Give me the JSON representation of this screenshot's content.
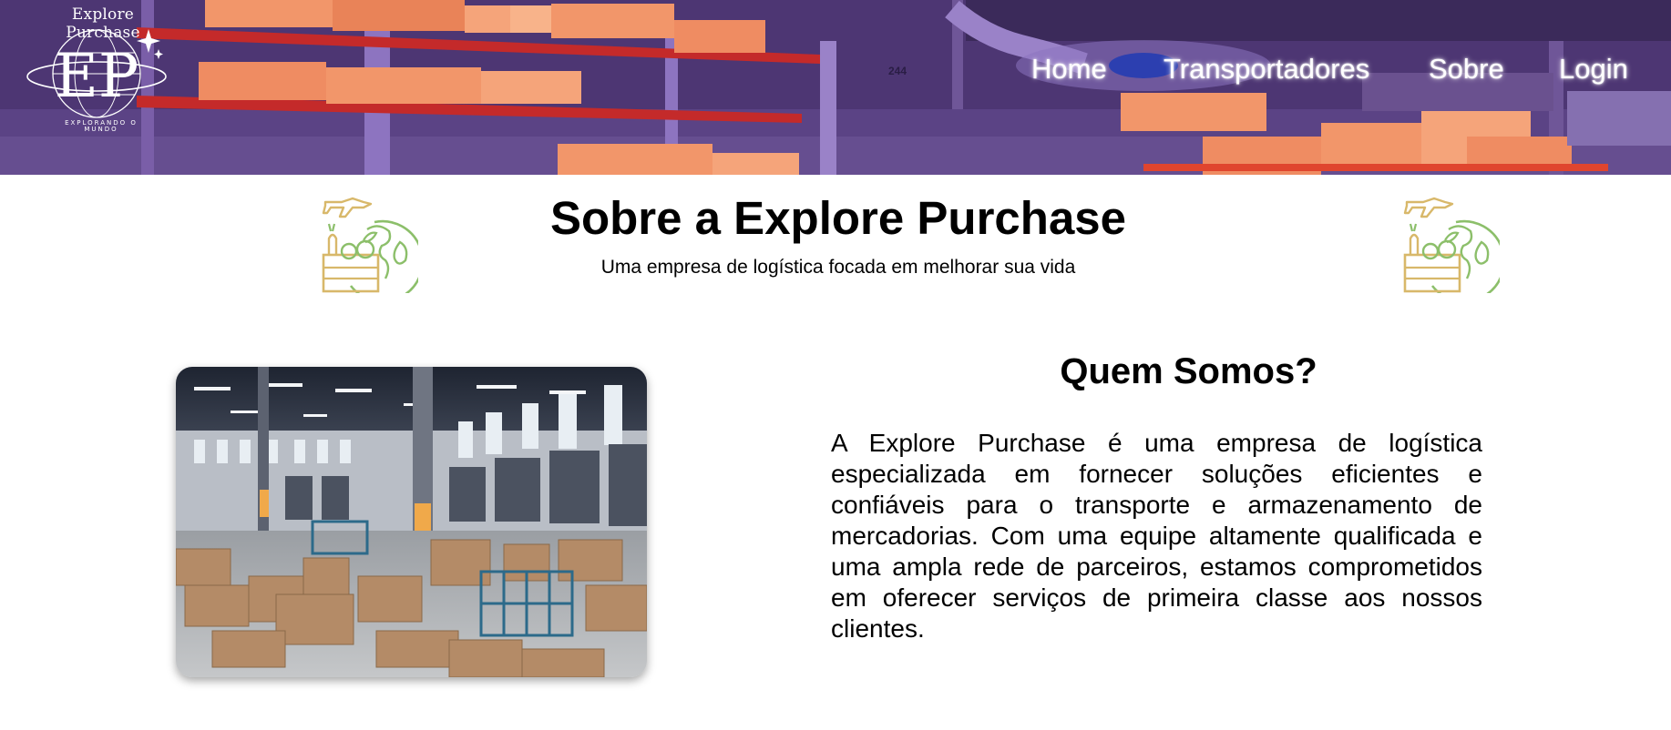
{
  "header": {
    "brand_name": "Explore Purchase",
    "logo_monogram": "EP",
    "logo_tagline": "EXPLORANDO O MUNDO",
    "nav": [
      {
        "label": "Home"
      },
      {
        "label": "Transportadores"
      },
      {
        "label": "Sobre"
      },
      {
        "label": "Login"
      }
    ],
    "banner_icon": "warehouse-shelves-illustration",
    "banner_sign": "244"
  },
  "intro": {
    "title": "Sobre a Explore Purchase",
    "subtitle": "Uma empresa de logística focada em melhorar sua vida",
    "icon": "global-produce-logistics-icon"
  },
  "about": {
    "heading": "Quem Somos?",
    "paragraph": "A Explore Purchase é uma empresa de logística especializada em fornecer soluções eficientes e confiáveis para o transporte e armazenamento de mercadorias. Com uma equipe altamente qualificada e uma ampla rede de parceiros, estamos comprometidos em oferecer serviços de primeira classe aos nossos clientes.",
    "image_icon": "warehouse-photo"
  },
  "colors": {
    "banner_purple": "#4a3470",
    "shelf_red": "#c42a2a",
    "box_orange": "#f2966a",
    "icon_gold": "#d8b86a",
    "icon_green": "#8cbf6a"
  }
}
